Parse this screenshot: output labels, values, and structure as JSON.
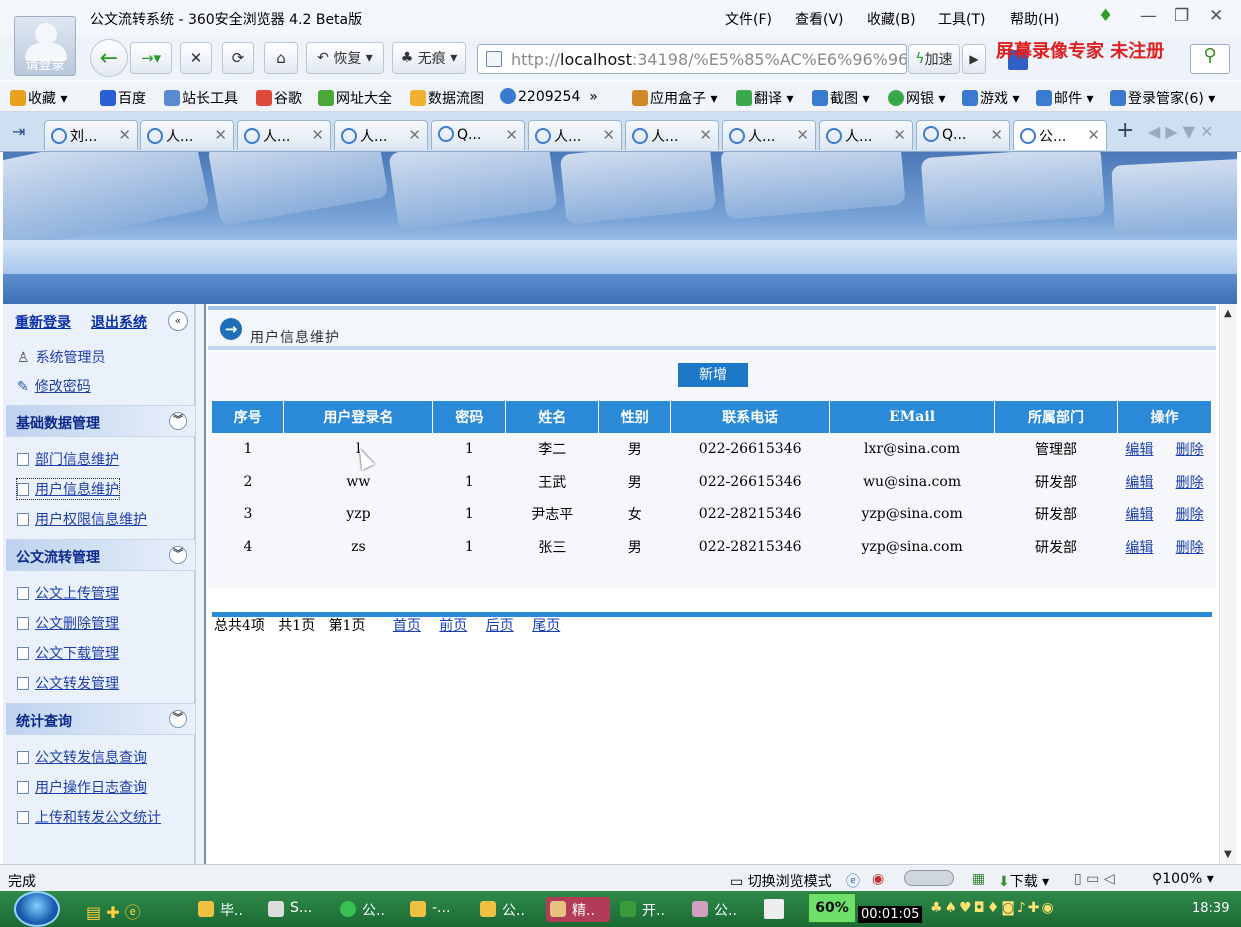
{
  "window": {
    "title": "公文流转系统 - 360安全浏览器 4.2 Beta版",
    "avatar_label": "请登录",
    "menus": [
      "文件(F)",
      "查看(V)",
      "收藏(B)",
      "工具(T)",
      "帮助(H)"
    ]
  },
  "toolbar": {
    "restore_label": "恢复",
    "incognito_label": "无痕",
    "address_prefix": "http://",
    "address_host": "localhost",
    "address_rest": ":34198/%E5%85%AC%E6%96%96",
    "speed_label": "加速",
    "watermark": "屏幕录像专家  未注册"
  },
  "bookmarks": [
    {
      "label": "收藏",
      "color": "#e8a020"
    },
    {
      "label": "百度",
      "color": "#2a5fd8"
    },
    {
      "label": "站长工具",
      "color": "#5a8ad0"
    },
    {
      "label": "谷歌",
      "color": "#e04a3a"
    },
    {
      "label": "网址大全",
      "color": "#4aa83a"
    },
    {
      "label": "数据流图",
      "color": "#f0b030"
    },
    {
      "label": "2209254",
      "color": "#3a7ad0"
    },
    {
      "label": "应用盒子",
      "color": "#d08a2a"
    },
    {
      "label": "翻译",
      "color": "#3aa84a"
    },
    {
      "label": "截图",
      "color": "#3a7ad0"
    },
    {
      "label": "网银",
      "color": "#3aa84a"
    },
    {
      "label": "游戏",
      "color": "#3a7ad0"
    },
    {
      "label": "邮件",
      "color": "#3a7ad0"
    },
    {
      "label": "登录管家(6)",
      "color": "#3a7ad0"
    }
  ],
  "tabs": [
    "刘...",
    "人...",
    "人...",
    "人...",
    "Q...",
    "人...",
    "人...",
    "人...",
    "人...",
    "Q...",
    "公..."
  ],
  "sidebar": {
    "relogin": "重新登录",
    "logout": "退出系统",
    "user_role": "系统管理员",
    "change_password": "修改密码",
    "groups": [
      {
        "title": "基础数据管理",
        "items": [
          "部门信息维护",
          "用户信息维护",
          "用户权限信息维护"
        ]
      },
      {
        "title": "公文流转管理",
        "items": [
          "公文上传管理",
          "公文删除管理",
          "公文下载管理",
          "公文转发管理"
        ]
      },
      {
        "title": "统计查询",
        "items": [
          "公文转发信息查询",
          "用户操作日志查询",
          "上传和转发公文统计"
        ]
      }
    ]
  },
  "content": {
    "breadcrumb": "用户信息维护",
    "add_button": "新增",
    "table": {
      "headers": [
        "序号",
        "用户登录名",
        "密码",
        "姓名",
        "性别",
        "联系电话",
        "EMail",
        "所属部门",
        "操作"
      ],
      "rows": [
        {
          "no": "1",
          "login": "l",
          "password": "1",
          "name": "李二",
          "gender": "男",
          "phone": "022-26615346",
          "email": "lxr@sina.com",
          "dept": "管理部",
          "edit": "编辑",
          "del": "删除"
        },
        {
          "no": "2",
          "login": "ww",
          "password": "1",
          "name": "王武",
          "gender": "男",
          "phone": "022-26615346",
          "email": "wu@sina.com",
          "dept": "研发部",
          "edit": "编辑",
          "del": "删除"
        },
        {
          "no": "3",
          "login": "yzp",
          "password": "1",
          "name": "尹志平",
          "gender": "女",
          "phone": "022-28215346",
          "email": "yzp@sina.com",
          "dept": "研发部",
          "edit": "编辑",
          "del": "删除"
        },
        {
          "no": "4",
          "login": "zs",
          "password": "1",
          "name": "张三",
          "gender": "男",
          "phone": "022-28215346",
          "email": "yzp@sina.com",
          "dept": "研发部",
          "edit": "编辑",
          "del": "删除"
        }
      ]
    },
    "pager": {
      "total": "总共4项",
      "pages": "共1页",
      "current": "第1页",
      "first": "首页",
      "prev": "前页",
      "next": "后页",
      "last": "尾页"
    }
  },
  "status": {
    "left": "完成",
    "mode": "切换浏览模式",
    "download": "下载",
    "zoom": "100%"
  },
  "taskbar": {
    "items": [
      "毕..",
      "S...",
      "公..",
      "-...",
      "公..",
      "精..",
      "开..",
      "公.."
    ],
    "meter": "60%",
    "timer": "00:01:05",
    "clock": "18:39"
  }
}
